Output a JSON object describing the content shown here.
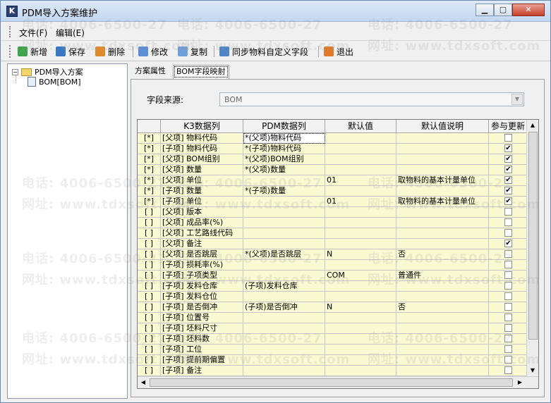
{
  "window": {
    "title": "PDM导入方案维护"
  },
  "menu": {
    "file": "文件(F)",
    "edit": "编辑(E)"
  },
  "toolbar": {
    "new": "新增",
    "save": "保存",
    "delete": "删除",
    "modify": "修改",
    "copy": "复制",
    "sync": "同步物料自定义字段",
    "exit": "退出"
  },
  "tree": {
    "root": "PDM导入方案",
    "child": "BOM[BOM]"
  },
  "tabs": {
    "properties": "方案属性",
    "mapping": "BOM字段映射"
  },
  "source": {
    "label": "字段来源:",
    "value": "BOM"
  },
  "grid": {
    "headers": {
      "k3": "K3数据列",
      "pdm": "PDM数据列",
      "default": "默认值",
      "desc": "默认值说明",
      "update": "参与更新"
    },
    "rows": [
      {
        "sel": "[*]",
        "k3": "[父项] 物料代码",
        "pdm": "*(父项)物料代码",
        "def": "",
        "desc": "",
        "chk": false
      },
      {
        "sel": "[*]",
        "k3": "[子项] 物料代码",
        "pdm": "*(子项)物料代码",
        "def": "",
        "desc": "",
        "chk": true
      },
      {
        "sel": "[*]",
        "k3": "[父项] BOM组别",
        "pdm": "*(父项)BOM组别",
        "def": "",
        "desc": "",
        "chk": true
      },
      {
        "sel": "[*]",
        "k3": "[父项] 数量",
        "pdm": "*(父项)数量",
        "def": "",
        "desc": "",
        "chk": true
      },
      {
        "sel": "[*]",
        "k3": "[父项] 单位",
        "pdm": "",
        "def": "01",
        "desc": "取物料的基本计量单位",
        "chk": true
      },
      {
        "sel": "[*]",
        "k3": "[子项] 数量",
        "pdm": "*(子项)数量",
        "def": "",
        "desc": "",
        "chk": true
      },
      {
        "sel": "[*]",
        "k3": "[子项] 单位",
        "pdm": "",
        "def": "01",
        "desc": "取物料的基本计量单位",
        "chk": true
      },
      {
        "sel": "[ ]",
        "k3": "[父项] 版本",
        "pdm": "",
        "def": "",
        "desc": "",
        "chk": false
      },
      {
        "sel": "[ ]",
        "k3": "[父项] 成品率(%)",
        "pdm": "",
        "def": "",
        "desc": "",
        "chk": false
      },
      {
        "sel": "[ ]",
        "k3": "[父项] 工艺路线代码",
        "pdm": "",
        "def": "",
        "desc": "",
        "chk": false
      },
      {
        "sel": "[ ]",
        "k3": "[父项] 备注",
        "pdm": "",
        "def": "",
        "desc": "",
        "chk": true
      },
      {
        "sel": "[ ]",
        "k3": "[父项] 是否跳层",
        "pdm": "*(父项)是否跳层",
        "def": "N",
        "desc": "否",
        "chk": false
      },
      {
        "sel": "[ ]",
        "k3": "[子项] 损耗率(%)",
        "pdm": "",
        "def": "",
        "desc": "",
        "chk": false
      },
      {
        "sel": "[ ]",
        "k3": "[子项] 子项类型",
        "pdm": "",
        "def": "COM",
        "desc": "普通件",
        "chk": false
      },
      {
        "sel": "[ ]",
        "k3": "[子项] 发料仓库",
        "pdm": "(子项)发料仓库",
        "def": "",
        "desc": "",
        "chk": false
      },
      {
        "sel": "[ ]",
        "k3": "[子项] 发料仓位",
        "pdm": "",
        "def": "",
        "desc": "",
        "chk": false
      },
      {
        "sel": "[ ]",
        "k3": "[子项] 是否倒冲",
        "pdm": "(子项)是否倒冲",
        "def": "N",
        "desc": "否",
        "chk": false
      },
      {
        "sel": "[ ]",
        "k3": "[子项] 位置号",
        "pdm": "",
        "def": "",
        "desc": "",
        "chk": false
      },
      {
        "sel": "[ ]",
        "k3": "[子项] 坯料尺寸",
        "pdm": "",
        "def": "",
        "desc": "",
        "chk": false
      },
      {
        "sel": "[ ]",
        "k3": "[子项] 坯料数",
        "pdm": "",
        "def": "",
        "desc": "",
        "chk": false
      },
      {
        "sel": "[ ]",
        "k3": "[子项] 工位",
        "pdm": "",
        "def": "",
        "desc": "",
        "chk": false
      },
      {
        "sel": "[ ]",
        "k3": "[子项] 提前期偏置",
        "pdm": "",
        "def": "",
        "desc": "",
        "chk": false
      },
      {
        "sel": "[ ]",
        "k3": "[子项] 备注",
        "pdm": "",
        "def": "",
        "desc": "",
        "chk": false
      }
    ]
  },
  "watermark": {
    "phone": "电话: 4006-6500-27",
    "site": "网址: www.tdxsoft.com"
  },
  "colors": {
    "cellBg": "#fafad2",
    "titleBar": "#c4d7ef",
    "closeBtn": "#c7402a"
  }
}
